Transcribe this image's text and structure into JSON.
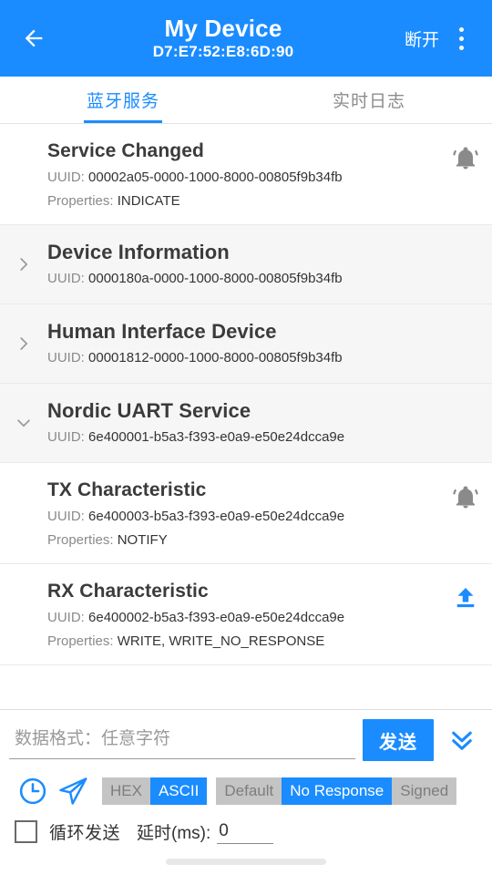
{
  "appbar": {
    "back_icon": "arrow-left-icon",
    "title": "My Device",
    "subtitle": "D7:E7:52:E8:6D:90",
    "disconnect_label": "断开",
    "overflow_icon": "more-vertical-icon",
    "background_color": "#1a8cff"
  },
  "tabs": [
    {
      "label": "蓝牙服务",
      "active": true
    },
    {
      "label": "实时日志",
      "active": false
    }
  ],
  "accent_color": "#1a8cff",
  "labels": {
    "uuid_prefix": "UUID:",
    "properties_prefix": "Properties:"
  },
  "list": [
    {
      "kind": "characteristic",
      "name": "Service Changed",
      "uuid": "00002a05-0000-1000-8000-00805f9b34fb",
      "properties": "INDICATE",
      "action_icon": "notifications-active-bell-icon",
      "action_color": "#8a8a8a",
      "expander": null
    },
    {
      "kind": "service",
      "name": "Device Information",
      "uuid": "0000180a-0000-1000-8000-00805f9b34fb",
      "properties": null,
      "action_icon": null,
      "action_color": null,
      "expander": "chevron-right-icon"
    },
    {
      "kind": "service",
      "name": "Human Interface Device",
      "uuid": "00001812-0000-1000-8000-00805f9b34fb",
      "properties": null,
      "action_icon": null,
      "action_color": null,
      "expander": "chevron-right-icon"
    },
    {
      "kind": "service",
      "name": "Nordic UART Service",
      "uuid": "6e400001-b5a3-f393-e0a9-e50e24dcca9e",
      "properties": null,
      "action_icon": null,
      "action_color": null,
      "expander": "chevron-down-icon"
    },
    {
      "kind": "characteristic",
      "name": "TX Characteristic",
      "uuid": "6e400003-b5a3-f393-e0a9-e50e24dcca9e",
      "properties": "NOTIFY",
      "action_icon": "notifications-active-bell-icon",
      "action_color": "#8a8a8a",
      "expander": null
    },
    {
      "kind": "characteristic",
      "name": "RX Characteristic",
      "uuid": "6e400002-b5a3-f393-e0a9-e50e24dcca9e",
      "properties": "WRITE, WRITE_NO_RESPONSE",
      "action_icon": "upload-icon",
      "action_color": "#1a8cff",
      "expander": null
    }
  ],
  "composer": {
    "input_placeholder": "数据格式：任意字符",
    "input_value": "",
    "send_label": "发送",
    "expand_icon": "double-chevron-down-icon",
    "history_icon": "clock-icon",
    "quick_send_icon": "paper-plane-icon",
    "format_options": [
      {
        "label": "HEX",
        "selected": false
      },
      {
        "label": "ASCII",
        "selected": true
      }
    ],
    "write_mode_options": [
      {
        "label": "Default",
        "selected": false
      },
      {
        "label": "No Response",
        "selected": true
      },
      {
        "label": "Signed",
        "selected": false
      }
    ],
    "loop_checkbox_label": "循环发送",
    "loop_checked": false,
    "delay_label": "延时(ms):",
    "delay_value": "0"
  },
  "navbar": {
    "pill": "gesture-nav-pill"
  }
}
